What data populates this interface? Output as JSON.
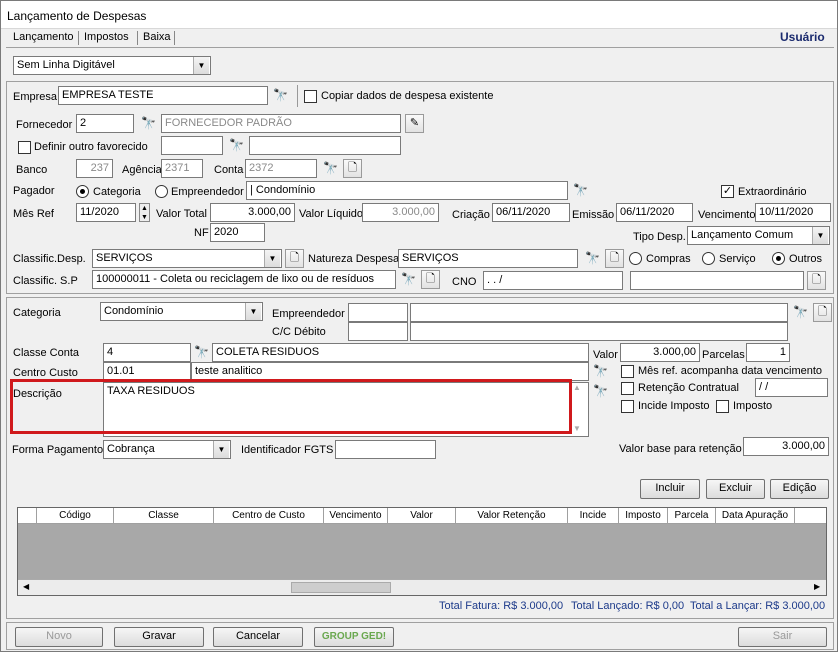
{
  "window": {
    "title": "Lançamento de Despesas",
    "user": "Usuário"
  },
  "tabs": [
    {
      "label": "Lançamento"
    },
    {
      "label": "Impostos"
    },
    {
      "label": "Baixa"
    }
  ],
  "top_select": "Sem Linha Digitável",
  "empresa": {
    "label": "Empresa",
    "value": "EMPRESA TESTE",
    "copy_label": "Copiar dados de despesa existente"
  },
  "fornecedor": {
    "label": "Fornecedor",
    "code": "2",
    "name": "FORNECEDOR PADRÃO",
    "outro_label": "Definir outro favorecido"
  },
  "banco": {
    "label": "Banco",
    "value": "237",
    "agencia_label": "Agência",
    "agencia": "2371",
    "conta_label": "Conta",
    "conta": "2372"
  },
  "pagador": {
    "label": "Pagador",
    "opt1": "Categoria",
    "opt2": "Empreendedor",
    "value": "| Condomínio",
    "extra_label": "Extraordinário"
  },
  "mesref": {
    "label": "Mês Ref",
    "value": "11/2020",
    "vt_label": "Valor Total",
    "vt": "3.000,00",
    "vl_label": "Valor Líquido",
    "vl": "3.000,00",
    "cri_label": "Criação",
    "cri": "06/11/2020",
    "emi_label": "Emissão",
    "emi": "06/11/2020",
    "ven_label": "Vencimento",
    "ven": "10/11/2020"
  },
  "nf": {
    "label": "NF",
    "value": "2020",
    "tipo_label": "Tipo Desp.",
    "tipo": "Lançamento Comum"
  },
  "classif": {
    "desp_label": "Classific.Desp.",
    "desp": "SERVIÇOS",
    "nat_label": "Natureza Despesa",
    "nat": "SERVIÇOS",
    "compras": "Compras",
    "servico": "Serviço",
    "outros": "Outros",
    "sp_label": "Classific. S.P",
    "sp": "100000011 - Coleta ou reciclagem de lixo ou de resíduos",
    "cno_label": "CNO",
    "cno": ".   .     /"
  },
  "categoria": {
    "label": "Categoria",
    "value": "Condomínio",
    "emp_label": "Empreendedor",
    "cc_label": "C/C Débito"
  },
  "classe": {
    "label": "Classe Conta",
    "code": "4",
    "name": "COLETA RESIDUOS",
    "valor_label": "Valor",
    "valor": "3.000,00",
    "parc_label": "Parcelas",
    "parc": "1"
  },
  "centro": {
    "label": "Centro Custo",
    "code": "01.01",
    "name": "teste analitico",
    "mes_label": "Mês ref. acompanha data vencimento",
    "ret_label": "Retenção Contratual",
    "ret": " /  /",
    "incide_label": "Incide Imposto",
    "imp_label": "Imposto"
  },
  "descricao": {
    "label": "Descrição",
    "value": "TAXA RESIDUOS"
  },
  "forma": {
    "label": "Forma Pagamento",
    "value": "Cobrança",
    "fgts_label": "Identificador FGTS",
    "vb_label": "Valor base para retenção",
    "vb": "3.000,00"
  },
  "actions": {
    "incluir": "Incluir",
    "excluir": "Excluir",
    "edicao": "Edição"
  },
  "grid": {
    "columns": [
      "Código",
      "Classe",
      "Centro de Custo",
      "Vencimento",
      "Valor",
      "Valor Retenção",
      "Incide",
      "Imposto",
      "Parcela",
      "Data Apuração"
    ]
  },
  "totals": {
    "fatura": "Total Fatura: R$ 3.000,00",
    "lancado": "Total Lançado: R$ 0,00",
    "lancar": "Total a Lançar: R$ 3.000,00"
  },
  "footer": {
    "novo": "Novo",
    "gravar": "Gravar",
    "cancelar": "Cancelar",
    "ged": "GROUP GED!",
    "sair": "Sair"
  }
}
